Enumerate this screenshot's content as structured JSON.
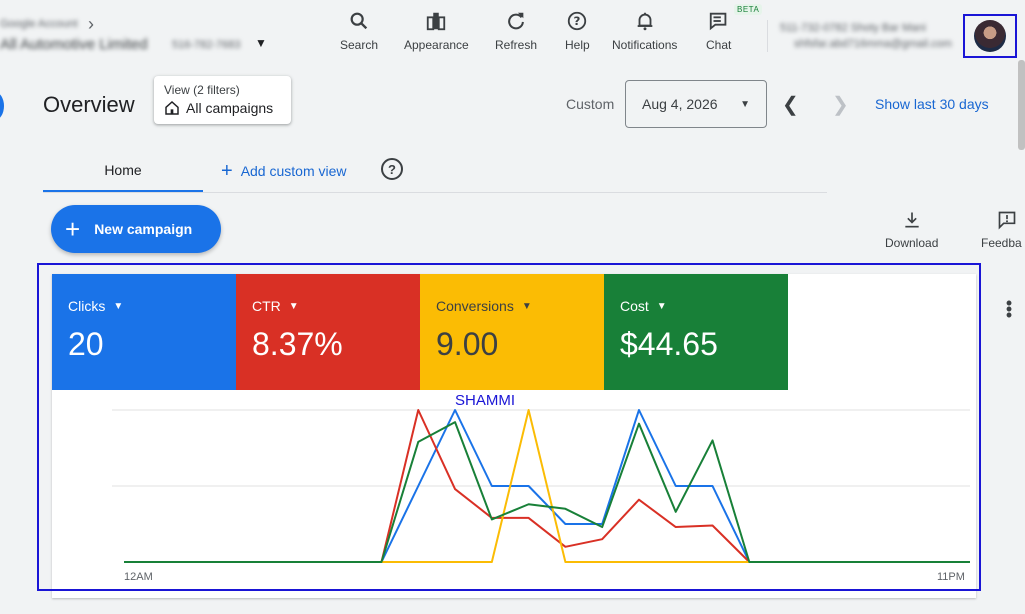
{
  "account": {
    "line1": "Google Account",
    "name": "All Automotive Limited",
    "customer_id": "516-782-7683"
  },
  "toolbar": {
    "items": [
      {
        "key": "search",
        "label": "Search",
        "icon": "search-icon"
      },
      {
        "key": "appearance",
        "label": "Appearance",
        "icon": "appearance-icon"
      },
      {
        "key": "refresh",
        "label": "Refresh",
        "icon": "refresh-icon"
      },
      {
        "key": "help",
        "label": "Help",
        "icon": "help-icon"
      },
      {
        "key": "notifications",
        "label": "Notifications",
        "icon": "bell-icon"
      },
      {
        "key": "chat",
        "label": "Chat",
        "icon": "chat-icon"
      }
    ],
    "chat_badge": "BETA"
  },
  "user": {
    "line1": "511-732-0782 Shoty Bar Mani",
    "line2": "shfsfar.abd716mma@gmail.com"
  },
  "overview": {
    "title": "Overview",
    "filter_line1": "View (2 filters)",
    "filter_line2": "All campaigns",
    "date_mode": "Custom",
    "date_value": "Aug 4, 2026",
    "show_last": "Show last 30 days"
  },
  "tabs": {
    "home": "Home",
    "add_custom_view": "Add custom view"
  },
  "actions": {
    "new_campaign": "New campaign",
    "download": "Download",
    "feedback": "Feedba"
  },
  "metrics": [
    {
      "label": "Clicks",
      "value": "20",
      "color": "#1a73e8"
    },
    {
      "label": "CTR",
      "value": "8.37%",
      "color": "#d93025"
    },
    {
      "label": "Conversions",
      "value": "9.00",
      "color": "#fbbc04"
    },
    {
      "label": "Cost",
      "value": "$44.65",
      "color": "#188038"
    }
  ],
  "chart_annotation": "SHAMMI",
  "chart_data": {
    "type": "line",
    "x_start_label": "12AM",
    "x_end_label": "11PM",
    "x": [
      0,
      1,
      2,
      3,
      4,
      5,
      6,
      7,
      8,
      9,
      10,
      11,
      12,
      13,
      14,
      15,
      16,
      17,
      18,
      19,
      20,
      21,
      22,
      23
    ],
    "ylim": [
      0,
      1
    ],
    "grid": true,
    "series": [
      {
        "color": "#1a73e8",
        "values": [
          0,
          0,
          0,
          0,
          0,
          0,
          0,
          0,
          0.5,
          1,
          0.5,
          0.5,
          0.25,
          0.25,
          1,
          0.5,
          0.5,
          0,
          0,
          0,
          0,
          0,
          0,
          0
        ]
      },
      {
        "color": "#d93025",
        "values": [
          0,
          0,
          0,
          0,
          0,
          0,
          0,
          0,
          1,
          0.48,
          0.29,
          0.29,
          0.1,
          0.15,
          0.41,
          0.23,
          0.24,
          0,
          0,
          0,
          0,
          0,
          0,
          0
        ]
      },
      {
        "color": "#fbbc04",
        "values": [
          0,
          0,
          0,
          0,
          0,
          0,
          0,
          0,
          0,
          0,
          0,
          1,
          0,
          0,
          0,
          0,
          0,
          0,
          0,
          0,
          0,
          0,
          0,
          0
        ]
      },
      {
        "color": "#188038",
        "values": [
          0,
          0,
          0,
          0,
          0,
          0,
          0,
          0,
          0.79,
          0.92,
          0.28,
          0.38,
          0.35,
          0.23,
          0.91,
          0.33,
          0.8,
          0,
          0,
          0,
          0,
          0,
          0,
          0
        ]
      }
    ]
  }
}
